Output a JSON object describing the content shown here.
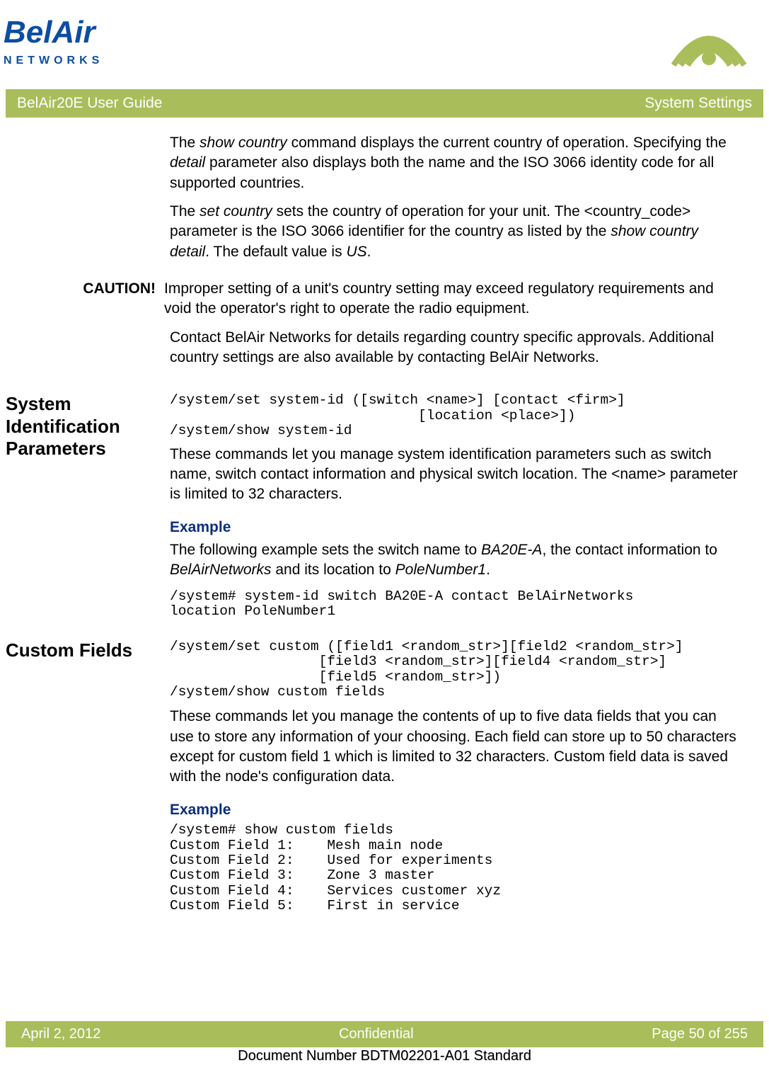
{
  "header": {
    "guide": "BelAir20E User Guide",
    "section": "System Settings"
  },
  "intro": {
    "p1_a": "The ",
    "p1_cmd": "show country",
    "p1_b": " command displays the current country of operation. Specifying the ",
    "p1_det": "detail",
    "p1_c": " parameter also displays both the name and the ISO 3066 identity code for all supported countries.",
    "p2_a": "The ",
    "p2_cmd": "set country",
    "p2_b": " sets the country of operation for your unit. The <country_code> parameter is the ISO 3066 identifier for the country as listed by the ",
    "p2_cmd2": "show country detail",
    "p2_c": ". The default value is ",
    "p2_us": "US",
    "p2_d": "."
  },
  "caution": {
    "label": "CAUTION!",
    "text": "Improper setting of a unit's country setting may exceed regulatory requirements and void the operator's right to operate the radio equipment.",
    "after": "Contact BelAir Networks for details regarding country specific approvals. Additional country settings are also available by contacting BelAir Networks."
  },
  "sysid": {
    "heading": "System Identification Parameters",
    "cmd": "/system/set system-id ([switch <name>] [contact <firm>]\n                              [location <place>])\n/system/show system-id",
    "desc": "These commands let you manage system identification parameters such as switch name, switch contact information and physical switch location. The <name> parameter is limited to 32 characters.",
    "ex_heading": "Example",
    "ex_a": "The following example sets the switch name to ",
    "ex_v1": "BA20E-A",
    "ex_b": ", the contact information to ",
    "ex_v2": "BelAirNetworks",
    "ex_c": " and its location to ",
    "ex_v3": "PoleNumber1",
    "ex_d": ".",
    "ex_cmd": "/system# system-id switch BA20E-A contact BelAirNetworks\nlocation PoleNumber1"
  },
  "custom": {
    "heading": "Custom Fields",
    "cmd": "/system/set custom ([field1 <random_str>][field2 <random_str>]\n                  [field3 <random_str>][field4 <random_str>]\n                  [field5 <random_str>])\n/system/show custom fields",
    "desc": "These commands let you manage the contents of up to five data fields that you can use to store any information of your choosing. Each field can store up to 50 characters except for custom field 1 which is limited to 32 characters. Custom field data is saved with the node's configuration data.",
    "ex_heading": "Example",
    "ex_out": "/system# show custom fields\nCustom Field 1:    Mesh main node\nCustom Field 2:    Used for experiments\nCustom Field 3:    Zone 3 master\nCustom Field 4:    Services customer xyz\nCustom Field 5:    First in service"
  },
  "footer": {
    "date": "April 2, 2012",
    "conf": "Confidential",
    "page": "Page 50 of 255",
    "docnum": "Document Number BDTM02201-A01 Standard"
  }
}
